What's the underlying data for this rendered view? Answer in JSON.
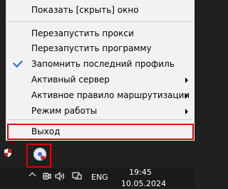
{
  "menu": {
    "items": [
      {
        "label": "Показать [скрыть] окно"
      },
      {
        "label": "Перезапустить прокси"
      },
      {
        "label": "Перезапустить программу"
      },
      {
        "label": "Запомнить последний профиль",
        "checked": true
      },
      {
        "label": "Активный сервер",
        "submenu": true
      },
      {
        "label": "Активное правило маршрутизации",
        "submenu": true
      },
      {
        "label": "Режим работы",
        "submenu": true
      },
      {
        "label": "Выход",
        "highlighted": true
      }
    ]
  },
  "tray": {
    "icons": [
      "security-shield-icon",
      "app-tray-icon"
    ],
    "highlighted": "app-tray-icon"
  },
  "taskbar": {
    "language": "ENG",
    "time": "19:45",
    "date": "10.05.2024",
    "icons": [
      "chevron-up-icon",
      "camera-icon",
      "volume-icon",
      "network-icon"
    ]
  },
  "colors": {
    "highlight_border": "#e00000",
    "menu_background": "#f2f2f2",
    "taskbar_background": "#1a1a1a",
    "check": "#1e6ed8"
  }
}
